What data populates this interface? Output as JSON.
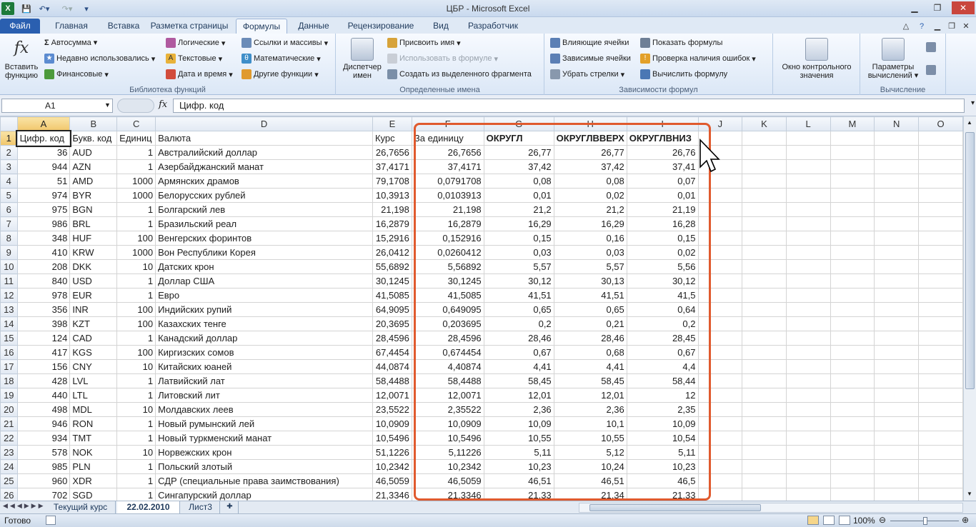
{
  "window": {
    "title": "ЦБР - Microsoft Excel"
  },
  "tabs": [
    "Файл",
    "Главная",
    "Вставка",
    "Разметка страницы",
    "Формулы",
    "Данные",
    "Рецензирование",
    "Вид",
    "Разработчик"
  ],
  "ribbon": {
    "insert_function": "Вставить функцию",
    "autosum": "Автосумма",
    "recent": "Недавно использовались",
    "financial": "Финансовые",
    "logical": "Логические",
    "text": "Текстовые",
    "datetime": "Дата и время",
    "lookup": "Ссылки и массивы",
    "math": "Математические",
    "other": "Другие функции",
    "group_library": "Библиотека функций",
    "name_manager": "Диспетчер имен",
    "assign_name": "Присвоить имя",
    "use_in_formula": "Использовать в формуле",
    "create_from_selection": "Создать из выделенного фрагмента",
    "group_names": "Определенные имена",
    "trace_precedents": "Влияющие ячейки",
    "trace_dependents": "Зависимые ячейки",
    "remove_arrows": "Убрать стрелки",
    "show_formulas": "Показать формулы",
    "error_checking": "Проверка наличия ошибок",
    "evaluate_formula": "Вычислить формулу",
    "group_audit": "Зависимости формул",
    "watch_window": "Окно контрольного значения",
    "calc_options": "Параметры вычислений",
    "group_calc": "Вычисление"
  },
  "formula_bar": {
    "name_box": "A1",
    "fx": "fx",
    "value": "Цифр. код"
  },
  "columns": [
    "A",
    "B",
    "C",
    "D",
    "E",
    "F",
    "G",
    "H",
    "I",
    "J",
    "K",
    "L",
    "M",
    "N",
    "O"
  ],
  "header_row": [
    "Цифр. код",
    "Букв. код",
    "Единиц",
    "Валюта",
    "Курс",
    "За единицу",
    "ОКРУГЛ",
    "ОКРУГЛВВЕРХ",
    "ОКРУГЛВНИЗ"
  ],
  "rows": [
    [
      "36",
      "AUD",
      "1",
      "Австралийский доллар",
      "26,7656",
      "26,7656",
      "26,77",
      "26,77",
      "26,76"
    ],
    [
      "944",
      "AZN",
      "1",
      "Азербайджанский манат",
      "37,4171",
      "37,4171",
      "37,42",
      "37,42",
      "37,41"
    ],
    [
      "51",
      "AMD",
      "1000",
      "Армянских драмов",
      "79,1708",
      "0,0791708",
      "0,08",
      "0,08",
      "0,07"
    ],
    [
      "974",
      "BYR",
      "1000",
      "Белорусских рублей",
      "10,3913",
      "0,0103913",
      "0,01",
      "0,02",
      "0,01"
    ],
    [
      "975",
      "BGN",
      "1",
      "Болгарский лев",
      "21,198",
      "21,198",
      "21,2",
      "21,2",
      "21,19"
    ],
    [
      "986",
      "BRL",
      "1",
      "Бразильский реал",
      "16,2879",
      "16,2879",
      "16,29",
      "16,29",
      "16,28"
    ],
    [
      "348",
      "HUF",
      "100",
      "Венгерских форинтов",
      "15,2916",
      "0,152916",
      "0,15",
      "0,16",
      "0,15"
    ],
    [
      "410",
      "KRW",
      "1000",
      "Вон Республики Корея",
      "26,0412",
      "0,0260412",
      "0,03",
      "0,03",
      "0,02"
    ],
    [
      "208",
      "DKK",
      "10",
      "Датских крон",
      "55,6892",
      "5,56892",
      "5,57",
      "5,57",
      "5,56"
    ],
    [
      "840",
      "USD",
      "1",
      "Доллар США",
      "30,1245",
      "30,1245",
      "30,12",
      "30,13",
      "30,12"
    ],
    [
      "978",
      "EUR",
      "1",
      "Евро",
      "41,5085",
      "41,5085",
      "41,51",
      "41,51",
      "41,5"
    ],
    [
      "356",
      "INR",
      "100",
      "Индийских рупий",
      "64,9095",
      "0,649095",
      "0,65",
      "0,65",
      "0,64"
    ],
    [
      "398",
      "KZT",
      "100",
      "Казахских тенге",
      "20,3695",
      "0,203695",
      "0,2",
      "0,21",
      "0,2"
    ],
    [
      "124",
      "CAD",
      "1",
      "Канадский доллар",
      "28,4596",
      "28,4596",
      "28,46",
      "28,46",
      "28,45"
    ],
    [
      "417",
      "KGS",
      "100",
      "Киргизских сомов",
      "67,4454",
      "0,674454",
      "0,67",
      "0,68",
      "0,67"
    ],
    [
      "156",
      "CNY",
      "10",
      "Китайских юаней",
      "44,0874",
      "4,40874",
      "4,41",
      "4,41",
      "4,4"
    ],
    [
      "428",
      "LVL",
      "1",
      "Латвийский лат",
      "58,4488",
      "58,4488",
      "58,45",
      "58,45",
      "58,44"
    ],
    [
      "440",
      "LTL",
      "1",
      "Литовский лит",
      "12,0071",
      "12,0071",
      "12,01",
      "12,01",
      "12"
    ],
    [
      "498",
      "MDL",
      "10",
      "Молдавских леев",
      "23,5522",
      "2,35522",
      "2,36",
      "2,36",
      "2,35"
    ],
    [
      "946",
      "RON",
      "1",
      "Новый румынский лей",
      "10,0909",
      "10,0909",
      "10,09",
      "10,1",
      "10,09"
    ],
    [
      "934",
      "TMT",
      "1",
      "Новый туркменский манат",
      "10,5496",
      "10,5496",
      "10,55",
      "10,55",
      "10,54"
    ],
    [
      "578",
      "NOK",
      "10",
      "Норвежских крон",
      "51,1226",
      "5,11226",
      "5,11",
      "5,12",
      "5,11"
    ],
    [
      "985",
      "PLN",
      "1",
      "Польский злотый",
      "10,2342",
      "10,2342",
      "10,23",
      "10,24",
      "10,23"
    ],
    [
      "960",
      "XDR",
      "1",
      "СДР (специальные права заимствования)",
      "46,5059",
      "46,5059",
      "46,51",
      "46,51",
      "46,5"
    ],
    [
      "702",
      "SGD",
      "1",
      "Сингапурский доллар",
      "21,3346",
      "21,3346",
      "21,33",
      "21,34",
      "21,33"
    ]
  ],
  "sheets": [
    "Текущий курс",
    "22.02.2010",
    "Лист3"
  ],
  "status": {
    "ready": "Готово",
    "zoom": "100%"
  }
}
